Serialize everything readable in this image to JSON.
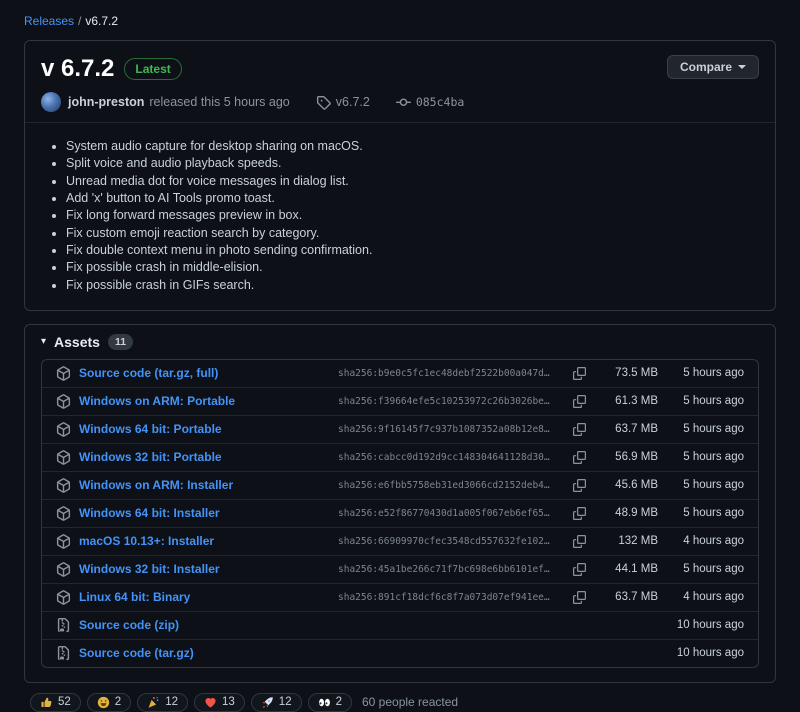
{
  "breadcrumb": {
    "parent": "Releases",
    "separator": "/",
    "current": "v6.7.2"
  },
  "release": {
    "title": "v 6.7.2",
    "latest_badge": "Latest",
    "compare_label": "Compare",
    "author": "john-preston",
    "released_text": "released this 5 hours ago",
    "tag": "v6.7.2",
    "commit": "085c4ba",
    "notes": [
      "System audio capture for desktop sharing on macOS.",
      "Split voice and audio playback speeds.",
      "Unread media dot for voice messages in dialog list.",
      "Add 'x' button to AI Tools promo toast.",
      "Fix long forward messages preview in box.",
      "Fix custom emoji reaction search by category.",
      "Fix double context menu in photo sending confirmation.",
      "Fix possible crash in middle-elision.",
      "Fix possible crash in GIFs search."
    ]
  },
  "assets": {
    "title": "Assets",
    "count": "11",
    "items": [
      {
        "icon": "package",
        "name": "Source code (tar.gz, full)",
        "hash": "sha256:b9e0c5fc1ec48debf2522b00a047d…",
        "size": "73.5 MB",
        "time": "5 hours ago"
      },
      {
        "icon": "package",
        "name": "Windows on ARM: Portable",
        "hash": "sha256:f39664efe5c10253972c26b3026be…",
        "size": "61.3 MB",
        "time": "5 hours ago"
      },
      {
        "icon": "package",
        "name": "Windows 64 bit: Portable",
        "hash": "sha256:9f16145f7c937b1087352a08b12e8…",
        "size": "63.7 MB",
        "time": "5 hours ago"
      },
      {
        "icon": "package",
        "name": "Windows 32 bit: Portable",
        "hash": "sha256:cabcc0d192d9cc148304641128d30…",
        "size": "56.9 MB",
        "time": "5 hours ago"
      },
      {
        "icon": "package",
        "name": "Windows on ARM: Installer",
        "hash": "sha256:e6fbb5758eb31ed3066cd2152deb4…",
        "size": "45.6 MB",
        "time": "5 hours ago"
      },
      {
        "icon": "package",
        "name": "Windows 64 bit: Installer",
        "hash": "sha256:e52f86770430d1a005f067eb6ef65…",
        "size": "48.9 MB",
        "time": "5 hours ago"
      },
      {
        "icon": "package",
        "name": "macOS 10.13+: Installer",
        "hash": "sha256:66909970cfec3548cd557632fe102…",
        "size": "132 MB",
        "time": "4 hours ago"
      },
      {
        "icon": "package",
        "name": "Windows 32 bit: Installer",
        "hash": "sha256:45a1be266c71f7bc698e6bb6101ef…",
        "size": "44.1 MB",
        "time": "5 hours ago"
      },
      {
        "icon": "package",
        "name": "Linux 64 bit: Binary",
        "hash": "sha256:891cf18dcf6c8f7a073d07ef941ee…",
        "size": "63.7 MB",
        "time": "4 hours ago"
      },
      {
        "icon": "file-zip",
        "name": "Source code (zip)",
        "hash": "",
        "size": "",
        "time": "10 hours ago"
      },
      {
        "icon": "file-zip",
        "name": "Source code (tar.gz)",
        "hash": "",
        "size": "",
        "time": "10 hours ago"
      }
    ]
  },
  "reactions": {
    "items": [
      {
        "emoji": "thumbs-up",
        "count": "52"
      },
      {
        "emoji": "laugh",
        "count": "2"
      },
      {
        "emoji": "hooray",
        "count": "12"
      },
      {
        "emoji": "heart",
        "count": "13"
      },
      {
        "emoji": "rocket",
        "count": "12"
      },
      {
        "emoji": "eyes",
        "count": "2"
      }
    ],
    "summary": "60 people reacted"
  },
  "colors": {
    "background": "#0d1117",
    "border": "#30363d",
    "link": "#4493f8",
    "latest_green": "#3fb950",
    "text": "#e6edf3",
    "muted": "#8b949e"
  }
}
